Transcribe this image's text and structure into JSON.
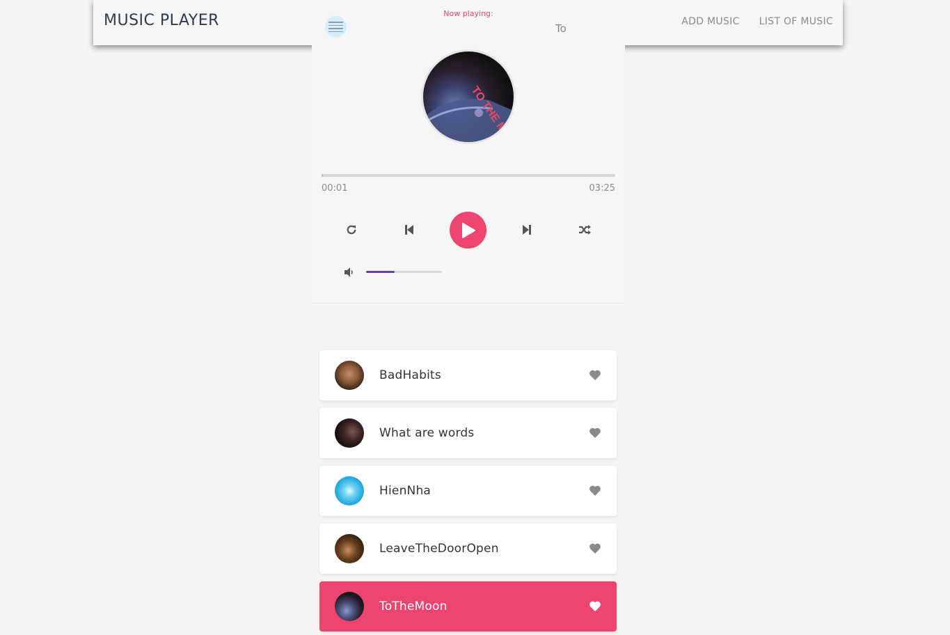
{
  "navbar": {
    "brand": "MUSIC PLAYER",
    "links": [
      {
        "label": "ADD MUSIC"
      },
      {
        "label": "LIST OF MUSIC"
      }
    ]
  },
  "player": {
    "now_playing_label": "Now playing:",
    "current_song_marquee": "ToTheMoon",
    "cd_art_text": "TO THE MOON",
    "time_current": "00:01",
    "time_total": "03:25",
    "progress_fraction": 0.005,
    "volume_fraction": 0.38,
    "colors": {
      "accent": "#ec4670",
      "volume": "#6c3fb0",
      "menu_bg": "#d6eefc"
    },
    "controls": [
      "repeat-icon",
      "previous-icon",
      "play-icon",
      "next-icon",
      "shuffle-icon"
    ]
  },
  "playlist": {
    "songs": [
      {
        "title": "BadHabits",
        "active": false
      },
      {
        "title": "What are words",
        "active": false
      },
      {
        "title": "HienNha",
        "active": false
      },
      {
        "title": "LeaveTheDoorOpen",
        "active": false
      },
      {
        "title": "ToTheMoon",
        "active": true
      }
    ]
  }
}
